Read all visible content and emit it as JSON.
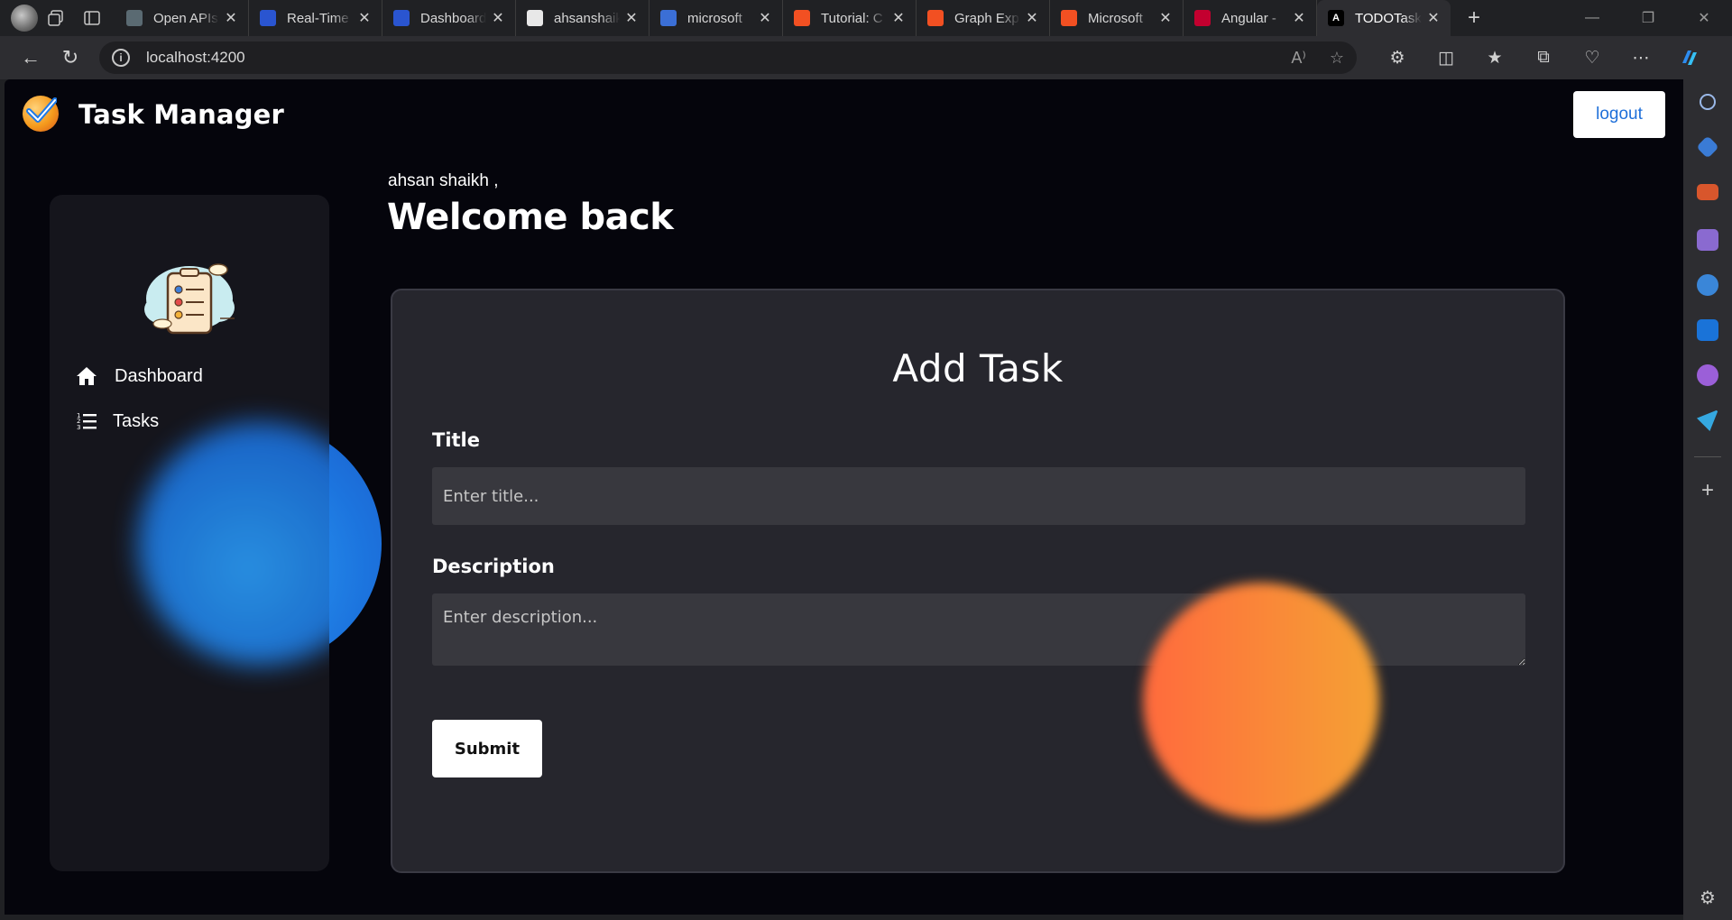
{
  "browser": {
    "tabs": [
      {
        "title": "Open APIs",
        "color": "#5a6a72"
      },
      {
        "title": "Real-Time",
        "color": "#2a55d0"
      },
      {
        "title": "Dashboard",
        "color": "#2a55d0"
      },
      {
        "title": "ahsanshaikh",
        "color": "#e8e8e8"
      },
      {
        "title": "microsoft",
        "color": "#3b6fd6"
      },
      {
        "title": "Tutorial: C",
        "color": "#f25022"
      },
      {
        "title": "Graph Exp",
        "color": "#f25022"
      },
      {
        "title": "Microsoft",
        "color": "#f25022"
      },
      {
        "title": "Angular -",
        "color": "#c3002f"
      },
      {
        "title": "TODOTask",
        "color": "#ffffff",
        "active": true
      }
    ],
    "url": "localhost:4200"
  },
  "app": {
    "title": "Task Manager",
    "logout_label": "logout"
  },
  "sidebar": {
    "items": [
      {
        "label": "Dashboard",
        "icon": "home-icon"
      },
      {
        "label": "Tasks",
        "icon": "list-icon"
      }
    ]
  },
  "greeting": {
    "name": "ahsan shaikh ,",
    "title": "Welcome back"
  },
  "form": {
    "heading": "Add Task",
    "title_label": "Title",
    "title_placeholder": "Enter title...",
    "title_value": "",
    "description_label": "Description",
    "description_placeholder": "Enter description...",
    "description_value": "",
    "submit_label": "Submit"
  },
  "colors": {
    "background": "#05050c",
    "card": "#26262d",
    "accent_blue": "#1c74de",
    "accent_orange": "#f5a234"
  }
}
